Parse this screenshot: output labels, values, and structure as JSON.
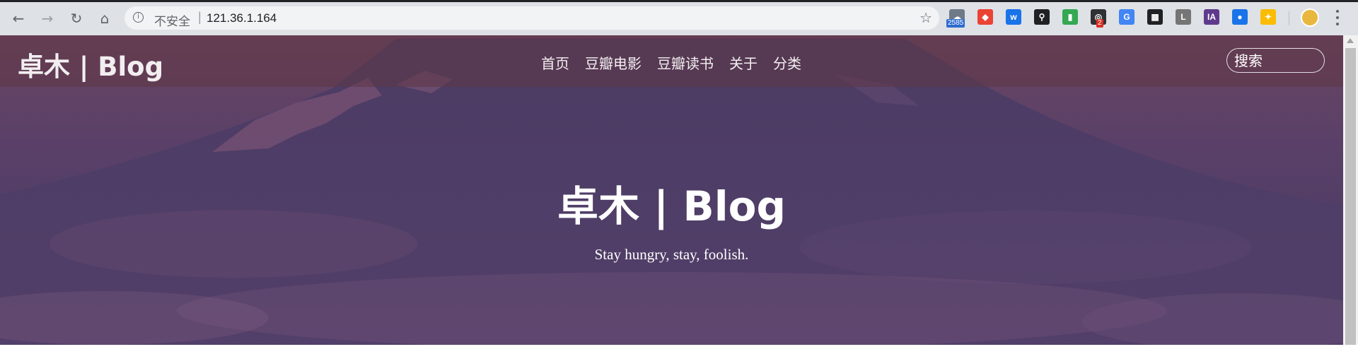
{
  "browser": {
    "nav": {
      "back": "←",
      "forward": "→",
      "reload": "↻",
      "home": "⌂"
    },
    "omnibox": {
      "info_glyph": "i",
      "insecure_label": "不安全",
      "separator": "|",
      "url": "121.36.1.164",
      "star_glyph": "☆"
    },
    "extensions": [
      {
        "name": "ext-1-icon",
        "glyph": "☁",
        "color": "#6f7a88",
        "badge": "2585",
        "badge_color": "#2f6bd1"
      },
      {
        "name": "ext-2-icon",
        "glyph": "◆",
        "color": "#ea4335",
        "badge": "",
        "badge_color": ""
      },
      {
        "name": "ext-3-icon",
        "glyph": "w",
        "color": "#1a73e8",
        "badge": "",
        "badge_color": ""
      },
      {
        "name": "ext-4-icon",
        "glyph": "⚲",
        "color": "#202124",
        "badge": "",
        "badge_color": ""
      },
      {
        "name": "ext-5-icon",
        "glyph": "▮",
        "color": "#34a853",
        "badge": "",
        "badge_color": ""
      },
      {
        "name": "ext-6-icon",
        "glyph": "◎",
        "color": "#303134",
        "badge": "2",
        "badge_color": "#d93025"
      },
      {
        "name": "ext-7-icon",
        "glyph": "G",
        "color": "#4285f4",
        "badge": "",
        "badge_color": ""
      },
      {
        "name": "ext-8-icon",
        "glyph": "▦",
        "color": "#202124",
        "badge": "",
        "badge_color": ""
      },
      {
        "name": "ext-9-icon",
        "glyph": "L",
        "color": "#757575",
        "badge": "",
        "badge_color": ""
      },
      {
        "name": "ext-10-icon",
        "glyph": "IA",
        "color": "#5e3a8c",
        "badge": "",
        "badge_color": ""
      },
      {
        "name": "ext-11-icon",
        "glyph": "●",
        "color": "#1a73e8",
        "badge": "",
        "badge_color": ""
      },
      {
        "name": "ext-12-icon",
        "glyph": "✦",
        "color": "#fbbc04",
        "badge": "",
        "badge_color": ""
      }
    ],
    "avatar_color": "#e8b73d"
  },
  "site": {
    "logo": "卓木 | Blog",
    "nav": [
      {
        "label": "首页"
      },
      {
        "label": "豆瓣电影"
      },
      {
        "label": "豆瓣读书"
      },
      {
        "label": "关于"
      },
      {
        "label": "分类"
      }
    ],
    "search_placeholder": "搜索",
    "hero_title": "卓木 | Blog",
    "hero_subtitle": "Stay hungry, stay, foolish."
  }
}
